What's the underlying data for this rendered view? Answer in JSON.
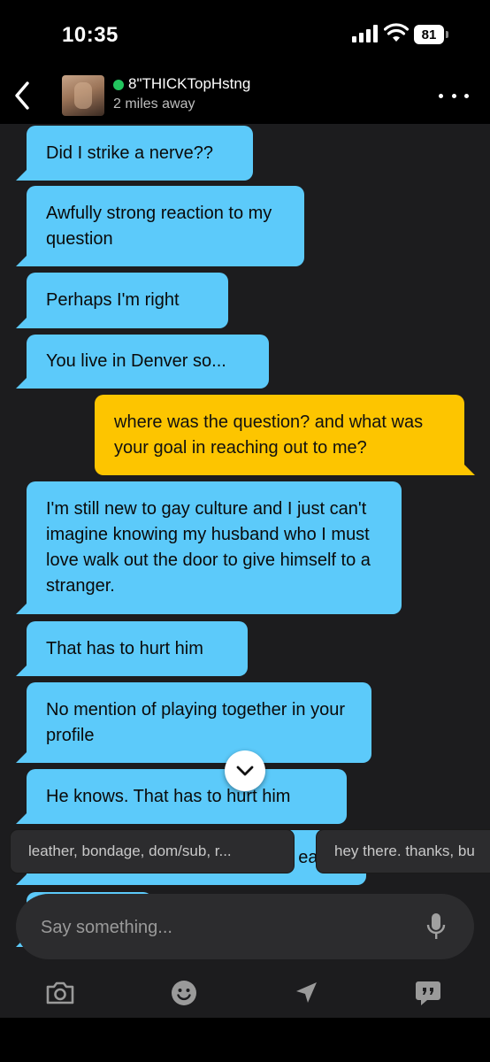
{
  "status_bar": {
    "time": "10:35",
    "battery": "81"
  },
  "header": {
    "name": "8\"THICKTopHstng",
    "distance": "2 miles away",
    "online_color": "#22c55e"
  },
  "messages": [
    {
      "from": "them",
      "text": "Did I strike a nerve??"
    },
    {
      "from": "them",
      "text": "Awfully strong reaction to my question"
    },
    {
      "from": "them",
      "text": "Perhaps I'm right"
    },
    {
      "from": "them",
      "text": "You live in Denver so..."
    },
    {
      "from": "me",
      "text": "where was the question? and what was your goal in reaching out to me?"
    },
    {
      "from": "them",
      "text": "I'm still new to gay culture and I just can't imagine knowing my husband who I must love walk out the door to give himself to a stranger."
    },
    {
      "from": "them",
      "text": "That has to hurt him"
    },
    {
      "from": "them",
      "text": "No mention of playing together in your profile"
    },
    {
      "from": "them",
      "text": "He knows. That has to hurt him"
    },
    {
      "from": "them",
      "text": "eal"
    }
  ],
  "quick_replies": [
    "leather, bondage, dom/sub, r...",
    "hey there. thanks, bu"
  ],
  "composer": {
    "placeholder": "Say something..."
  },
  "colors": {
    "incoming_bubble": "#5ccafa",
    "outgoing_bubble": "#fdc500",
    "chat_background": "#1c1c1e"
  },
  "icons": {
    "back": "chevron-left-icon",
    "more": "more-horizontal-icon",
    "scroll": "chevron-down-icon",
    "mic": "microphone-icon",
    "camera": "camera-icon",
    "emoji": "smiley-icon",
    "location": "location-arrow-icon",
    "phrases": "quote-bubble-icon"
  }
}
